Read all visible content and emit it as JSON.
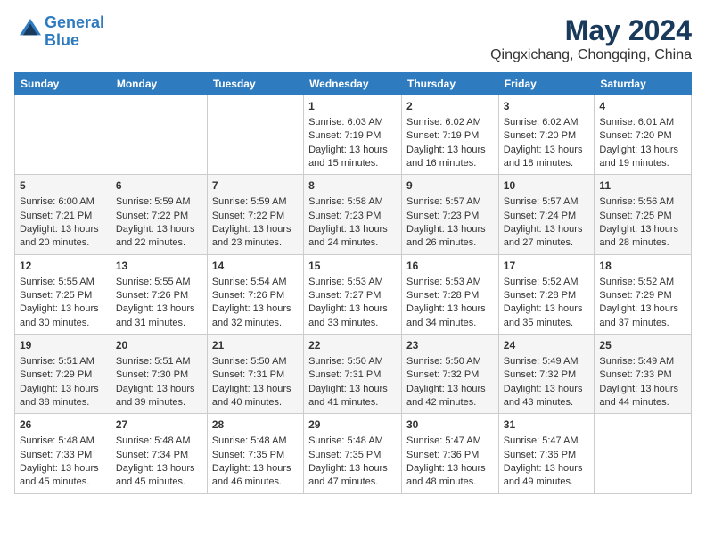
{
  "header": {
    "logo_line1": "General",
    "logo_line2": "Blue",
    "month": "May 2024",
    "location": "Qingxichang, Chongqing, China"
  },
  "weekdays": [
    "Sunday",
    "Monday",
    "Tuesday",
    "Wednesday",
    "Thursday",
    "Friday",
    "Saturday"
  ],
  "weeks": [
    [
      {
        "day": "",
        "info": ""
      },
      {
        "day": "",
        "info": ""
      },
      {
        "day": "",
        "info": ""
      },
      {
        "day": "1",
        "info": "Sunrise: 6:03 AM\nSunset: 7:19 PM\nDaylight: 13 hours\nand 15 minutes."
      },
      {
        "day": "2",
        "info": "Sunrise: 6:02 AM\nSunset: 7:19 PM\nDaylight: 13 hours\nand 16 minutes."
      },
      {
        "day": "3",
        "info": "Sunrise: 6:02 AM\nSunset: 7:20 PM\nDaylight: 13 hours\nand 18 minutes."
      },
      {
        "day": "4",
        "info": "Sunrise: 6:01 AM\nSunset: 7:20 PM\nDaylight: 13 hours\nand 19 minutes."
      }
    ],
    [
      {
        "day": "5",
        "info": "Sunrise: 6:00 AM\nSunset: 7:21 PM\nDaylight: 13 hours\nand 20 minutes."
      },
      {
        "day": "6",
        "info": "Sunrise: 5:59 AM\nSunset: 7:22 PM\nDaylight: 13 hours\nand 22 minutes."
      },
      {
        "day": "7",
        "info": "Sunrise: 5:59 AM\nSunset: 7:22 PM\nDaylight: 13 hours\nand 23 minutes."
      },
      {
        "day": "8",
        "info": "Sunrise: 5:58 AM\nSunset: 7:23 PM\nDaylight: 13 hours\nand 24 minutes."
      },
      {
        "day": "9",
        "info": "Sunrise: 5:57 AM\nSunset: 7:23 PM\nDaylight: 13 hours\nand 26 minutes."
      },
      {
        "day": "10",
        "info": "Sunrise: 5:57 AM\nSunset: 7:24 PM\nDaylight: 13 hours\nand 27 minutes."
      },
      {
        "day": "11",
        "info": "Sunrise: 5:56 AM\nSunset: 7:25 PM\nDaylight: 13 hours\nand 28 minutes."
      }
    ],
    [
      {
        "day": "12",
        "info": "Sunrise: 5:55 AM\nSunset: 7:25 PM\nDaylight: 13 hours\nand 30 minutes."
      },
      {
        "day": "13",
        "info": "Sunrise: 5:55 AM\nSunset: 7:26 PM\nDaylight: 13 hours\nand 31 minutes."
      },
      {
        "day": "14",
        "info": "Sunrise: 5:54 AM\nSunset: 7:26 PM\nDaylight: 13 hours\nand 32 minutes."
      },
      {
        "day": "15",
        "info": "Sunrise: 5:53 AM\nSunset: 7:27 PM\nDaylight: 13 hours\nand 33 minutes."
      },
      {
        "day": "16",
        "info": "Sunrise: 5:53 AM\nSunset: 7:28 PM\nDaylight: 13 hours\nand 34 minutes."
      },
      {
        "day": "17",
        "info": "Sunrise: 5:52 AM\nSunset: 7:28 PM\nDaylight: 13 hours\nand 35 minutes."
      },
      {
        "day": "18",
        "info": "Sunrise: 5:52 AM\nSunset: 7:29 PM\nDaylight: 13 hours\nand 37 minutes."
      }
    ],
    [
      {
        "day": "19",
        "info": "Sunrise: 5:51 AM\nSunset: 7:29 PM\nDaylight: 13 hours\nand 38 minutes."
      },
      {
        "day": "20",
        "info": "Sunrise: 5:51 AM\nSunset: 7:30 PM\nDaylight: 13 hours\nand 39 minutes."
      },
      {
        "day": "21",
        "info": "Sunrise: 5:50 AM\nSunset: 7:31 PM\nDaylight: 13 hours\nand 40 minutes."
      },
      {
        "day": "22",
        "info": "Sunrise: 5:50 AM\nSunset: 7:31 PM\nDaylight: 13 hours\nand 41 minutes."
      },
      {
        "day": "23",
        "info": "Sunrise: 5:50 AM\nSunset: 7:32 PM\nDaylight: 13 hours\nand 42 minutes."
      },
      {
        "day": "24",
        "info": "Sunrise: 5:49 AM\nSunset: 7:32 PM\nDaylight: 13 hours\nand 43 minutes."
      },
      {
        "day": "25",
        "info": "Sunrise: 5:49 AM\nSunset: 7:33 PM\nDaylight: 13 hours\nand 44 minutes."
      }
    ],
    [
      {
        "day": "26",
        "info": "Sunrise: 5:48 AM\nSunset: 7:33 PM\nDaylight: 13 hours\nand 45 minutes."
      },
      {
        "day": "27",
        "info": "Sunrise: 5:48 AM\nSunset: 7:34 PM\nDaylight: 13 hours\nand 45 minutes."
      },
      {
        "day": "28",
        "info": "Sunrise: 5:48 AM\nSunset: 7:35 PM\nDaylight: 13 hours\nand 46 minutes."
      },
      {
        "day": "29",
        "info": "Sunrise: 5:48 AM\nSunset: 7:35 PM\nDaylight: 13 hours\nand 47 minutes."
      },
      {
        "day": "30",
        "info": "Sunrise: 5:47 AM\nSunset: 7:36 PM\nDaylight: 13 hours\nand 48 minutes."
      },
      {
        "day": "31",
        "info": "Sunrise: 5:47 AM\nSunset: 7:36 PM\nDaylight: 13 hours\nand 49 minutes."
      },
      {
        "day": "",
        "info": ""
      }
    ]
  ]
}
